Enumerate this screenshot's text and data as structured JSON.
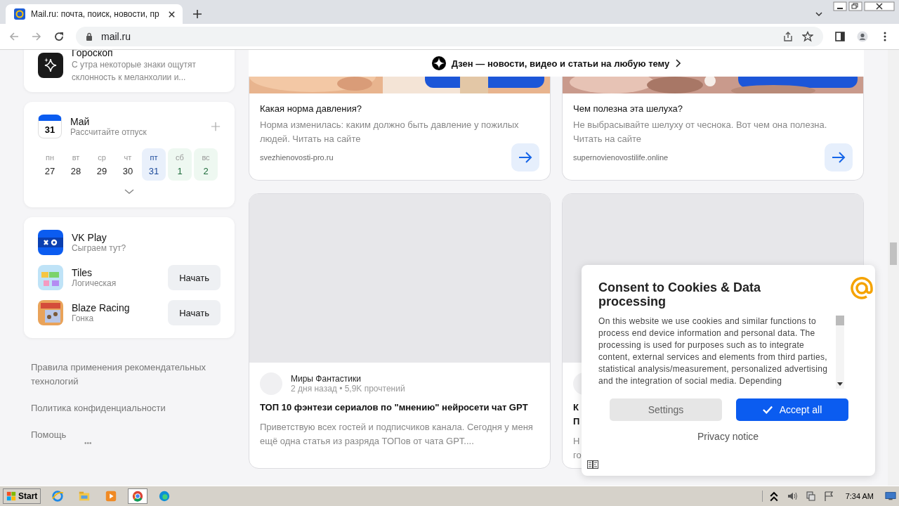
{
  "browser": {
    "tab": {
      "title": "Mail.ru: почта, поиск, новости, пр",
      "selected": true
    },
    "url": "mail.ru"
  },
  "sidebar": {
    "horoscope": {
      "title": "Гороскоп",
      "text": "С утра некоторые знаки ощутят склонность к меланхолии и..."
    },
    "calendar": {
      "icon_day": "31",
      "month": "Май",
      "subtitle": "Рассчитайте отпуск",
      "days": [
        {
          "weekday": "пн",
          "date": "27",
          "kind": "weekday",
          "selected": false
        },
        {
          "weekday": "вт",
          "date": "28",
          "kind": "weekday",
          "selected": false
        },
        {
          "weekday": "ср",
          "date": "29",
          "kind": "weekday",
          "selected": false
        },
        {
          "weekday": "чт",
          "date": "30",
          "kind": "weekday",
          "selected": false
        },
        {
          "weekday": "пт",
          "date": "31",
          "kind": "weekday",
          "selected": true
        },
        {
          "weekday": "сб",
          "date": "1",
          "kind": "weekend",
          "selected": false
        },
        {
          "weekday": "вс",
          "date": "2",
          "kind": "weekend",
          "selected": false
        }
      ]
    },
    "games": {
      "title": "VK Play",
      "subtitle": "Сыграем тут?",
      "items": [
        {
          "name": "Tiles",
          "genre": "Логическая",
          "button": "Начать"
        },
        {
          "name": "Blaze Racing",
          "genre": "Гонка",
          "button": "Начать"
        }
      ]
    },
    "links": [
      "Правила применения рекомендательных технологий",
      "Политика конфиденциальности",
      "Помощь"
    ],
    "more": "•••"
  },
  "feed": {
    "banner": "Дзен — новости, видео и статьи на любую тему",
    "ads": [
      {
        "title": "Какая норма давления?",
        "text": "Норма изменилась: каким должно быть давление у пожилых людей. Читать на сайте",
        "domain": "svezhienovosti-pro.ru"
      },
      {
        "title": "Чем полезна эта шелуха?",
        "text": "Не выбрасывайте шелуху от чеснока. Вот чем она полезна. Читать на сайте",
        "domain": "supernovienovostilife.online"
      }
    ],
    "articles": [
      {
        "channel": "Миры Фантастики",
        "meta": "2 дня назад • 5,9K прочтений",
        "title": "ТОП 10 фэнтези сериалов по \"мнению\" нейросети чат GPT",
        "text": "Приветствую всех гостей и подписчиков канала. Сегодня у меня ещё одна статья из разряда ТОПов от чата GPT...."
      },
      {
        "title_lines": [
          "К",
          "П"
        ],
        "text_lines": [
          "Н",
          "го"
        ]
      }
    ]
  },
  "cookie_dialog": {
    "title": "Consent to Cookies & Data processing",
    "text": "On this website we use cookies and similar functions to process end device information and personal data. The processing is used for purposes such as to integrate content, external services and elements from third parties, statistical analysis/measurement, personalized advertising and the integration of social media. Depending",
    "buttons": [
      {
        "label": "Settings",
        "kind": "secondary"
      },
      {
        "label": "Accept all",
        "kind": "primary"
      }
    ],
    "link": "Privacy notice"
  },
  "taskbar": {
    "start": "Start",
    "apps": [
      {
        "selected": false
      },
      {
        "selected": false
      },
      {
        "selected": false
      },
      {
        "selected": true
      },
      {
        "selected": false
      }
    ],
    "time": "7:34 AM"
  }
}
